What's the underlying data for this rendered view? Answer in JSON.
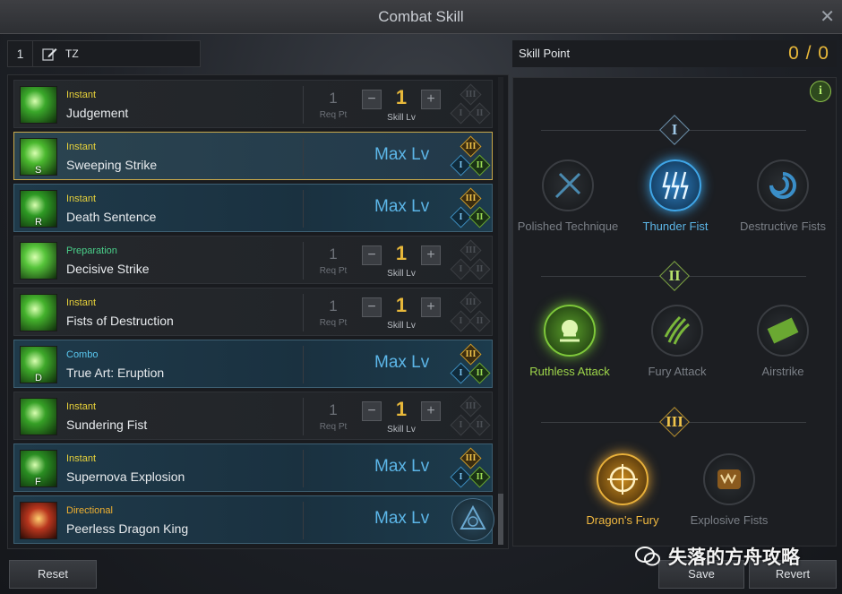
{
  "window": {
    "title": "Combat Skill"
  },
  "preset": {
    "number": "1",
    "name": "TZ"
  },
  "skill_point": {
    "label": "Skill Point",
    "value": "0 / 0"
  },
  "labels": {
    "req_pt": "Req Pt",
    "skill_lv": "Skill Lv",
    "max_lv": "Max Lv"
  },
  "skills": [
    {
      "type": "Instant",
      "name": "Judgement",
      "key": "",
      "req": "1",
      "level": "1",
      "max": false,
      "type_color": "#e8d23a",
      "icon_color": "#3aa82a"
    },
    {
      "type": "Instant",
      "name": "Sweeping Strike",
      "key": "S",
      "max": true,
      "selected": true,
      "type_color": "#e8d23a",
      "icon_color": "#4ab82e"
    },
    {
      "type": "Instant",
      "name": "Death Sentence",
      "key": "R",
      "max": true,
      "type_color": "#e8d23a",
      "icon_color": "#2e9a24"
    },
    {
      "type": "Preparation",
      "name": "Decisive Strike",
      "key": "",
      "req": "1",
      "level": "1",
      "max": false,
      "type_color": "#4ad08a",
      "icon_color": "#56c43a"
    },
    {
      "type": "Instant",
      "name": "Fists of Destruction",
      "key": "",
      "req": "1",
      "level": "1",
      "max": false,
      "type_color": "#e8d23a",
      "icon_color": "#44b22c"
    },
    {
      "type": "Combo",
      "name": "True Art: Eruption",
      "key": "D",
      "max": true,
      "type_color": "#5ac8f0",
      "icon_color": "#3ea82a"
    },
    {
      "type": "Instant",
      "name": "Sundering Fist",
      "key": "",
      "req": "1",
      "level": "1",
      "max": false,
      "type_color": "#e8d23a",
      "icon_color": "#36a026"
    },
    {
      "type": "Instant",
      "name": "Supernova Explosion",
      "key": "F",
      "max": true,
      "type_color": "#e8d23a",
      "icon_color": "#2a8e22"
    },
    {
      "type": "Directional",
      "name": "Peerless Dragon King",
      "key": "",
      "max": true,
      "awakening": true,
      "type_color": "#f0b030",
      "icon_color": "#b8361e"
    }
  ],
  "tripod_tiers": {
    "tier1": {
      "numeral": "I",
      "nodes": [
        {
          "name": "Polished Technique",
          "state": "dim"
        },
        {
          "name": "Thunder Fist",
          "state": "selected"
        },
        {
          "name": "Destructive Fists",
          "state": "dim"
        }
      ]
    },
    "tier2": {
      "numeral": "II",
      "nodes": [
        {
          "name": "Ruthless Attack",
          "state": "selected"
        },
        {
          "name": "Fury Attack",
          "state": "dim"
        },
        {
          "name": "Airstrike",
          "state": "dim"
        }
      ]
    },
    "tier3": {
      "numeral": "III",
      "nodes": [
        {
          "name": "Dragon's Fury",
          "state": "selected"
        },
        {
          "name": "Explosive Fists",
          "state": "dim"
        }
      ]
    }
  },
  "buttons": {
    "reset": "Reset",
    "save": "Save",
    "revert": "Revert",
    "info": "i"
  },
  "tripod_numerals": {
    "one": "I",
    "two": "II",
    "three": "III"
  },
  "watermark": "失落的方舟攻略"
}
